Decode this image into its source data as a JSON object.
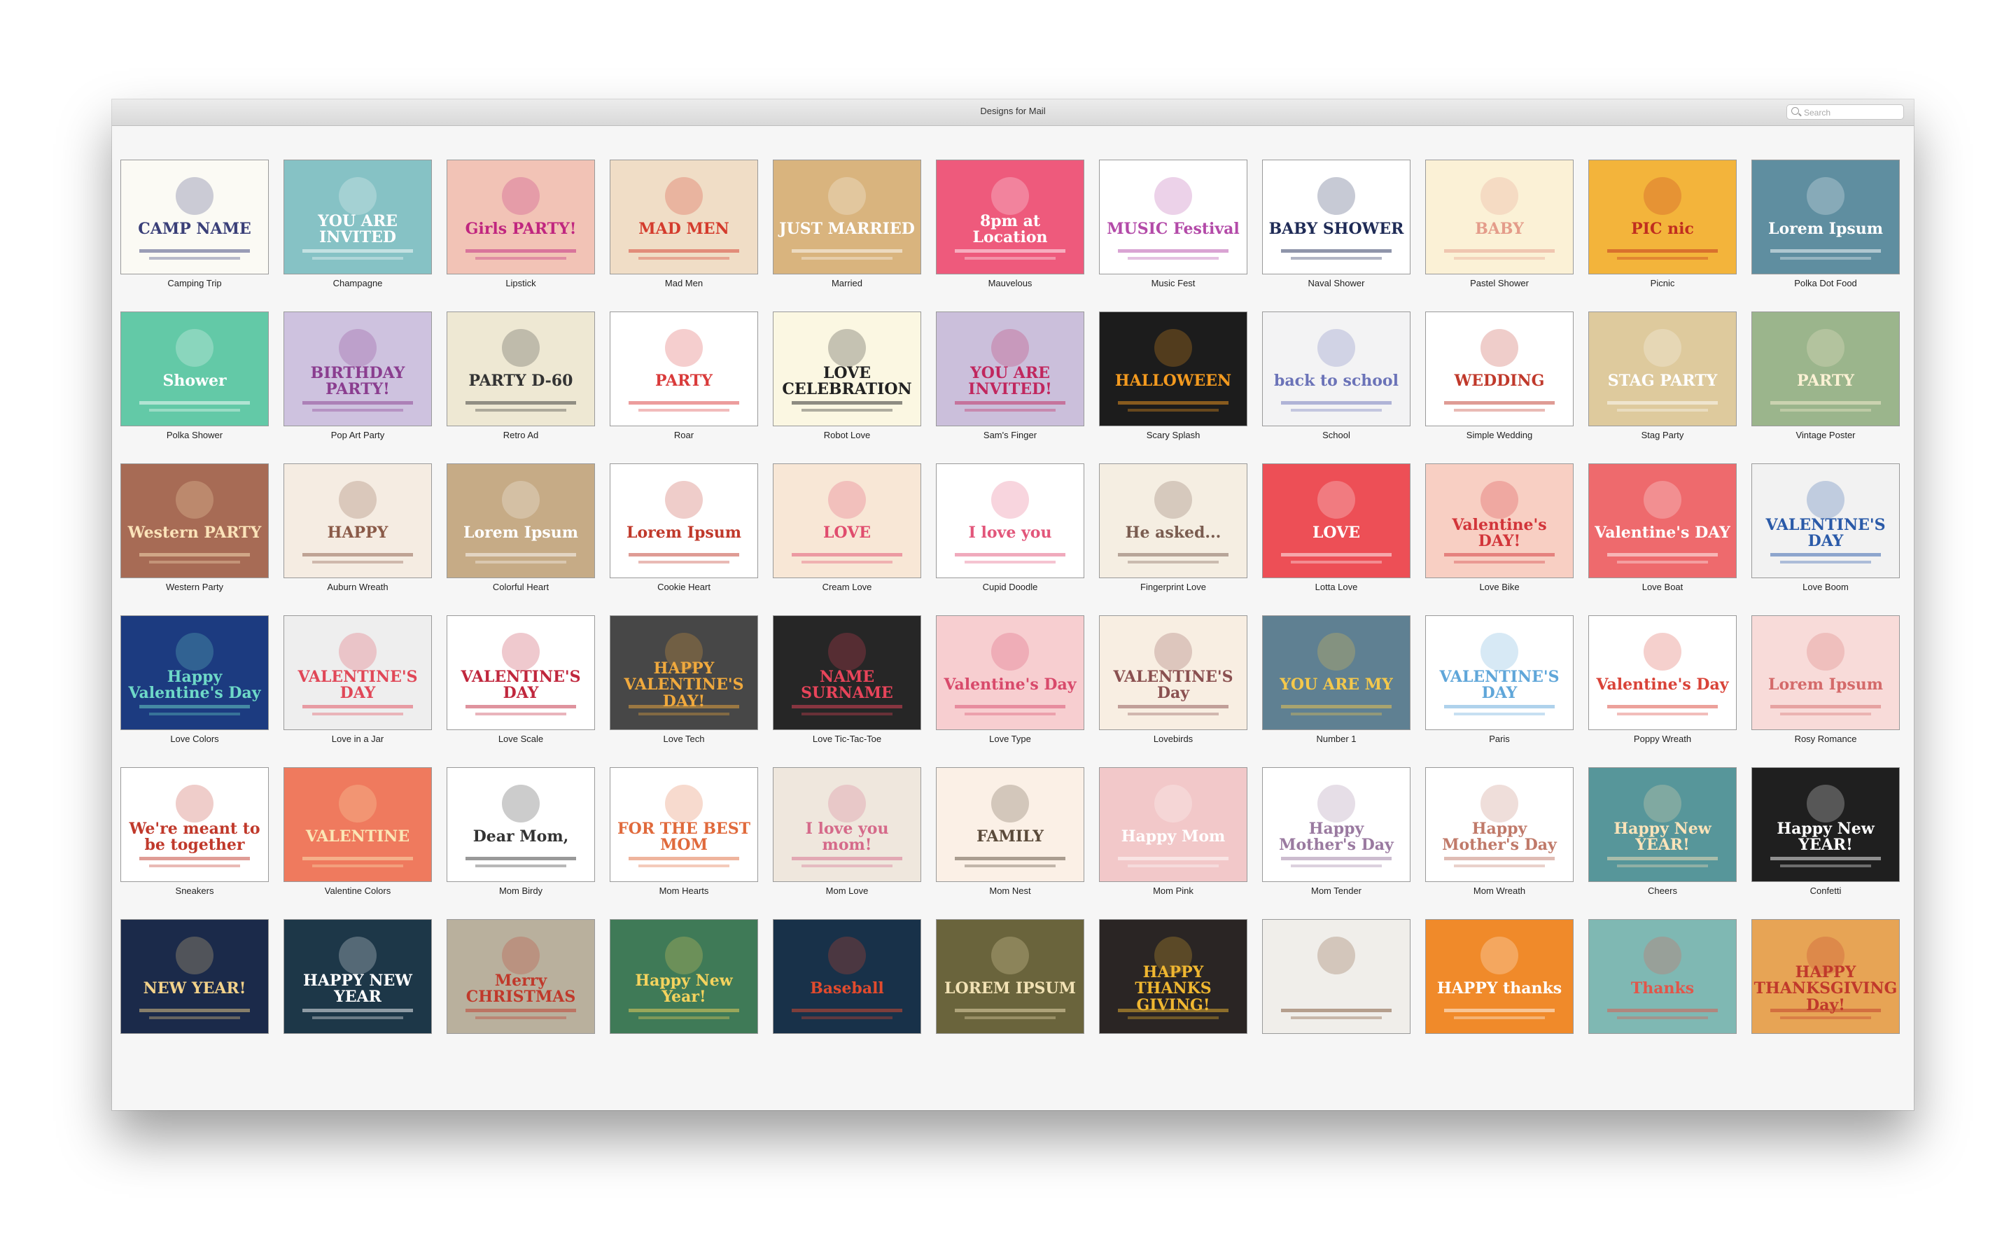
{
  "window": {
    "title": "Designs for Mail",
    "search": {
      "placeholder": "Search",
      "value": ""
    }
  },
  "designs": [
    {
      "name": "Camping Trip",
      "bg": "#fbfaf4",
      "fg": "#3a3f78",
      "hl": "CAMP NAME"
    },
    {
      "name": "Champagne",
      "bg": "#86c2c5",
      "fg": "#ffffff",
      "hl": "YOU ARE INVITED"
    },
    {
      "name": "Lipstick",
      "bg": "#f2c3b6",
      "fg": "#c0267f",
      "hl": "Girls PARTY!"
    },
    {
      "name": "Mad Men",
      "bg": "#f0ddc6",
      "fg": "#d43c2d",
      "hl": "MAD MEN"
    },
    {
      "name": "Married",
      "bg": "#d9b47e",
      "fg": "#ffffff",
      "hl": "JUST MARRIED"
    },
    {
      "name": "Mauvelous",
      "bg": "#ee5a7c",
      "fg": "#ffffff",
      "hl": "8pm at Location"
    },
    {
      "name": "Music Fest",
      "bg": "#ffffff",
      "fg": "#b34aa8",
      "hl": "MUSIC Festival"
    },
    {
      "name": "Naval Shower",
      "bg": "#ffffff",
      "fg": "#1f2b56",
      "hl": "BABY SHOWER"
    },
    {
      "name": "Pastel Shower",
      "bg": "#fbf1d6",
      "fg": "#e49c8a",
      "hl": "BABY"
    },
    {
      "name": "Picnic",
      "bg": "#f3b43b",
      "fg": "#c02e1f",
      "hl": "PIC nic"
    },
    {
      "name": "Polka Dot Food",
      "bg": "#5f8ea0",
      "fg": "#ffffff",
      "hl": "Lorem Ipsum"
    },
    {
      "name": "Polka Shower",
      "bg": "#63c9a7",
      "fg": "#ffffff",
      "hl": "Shower"
    },
    {
      "name": "Pop Art Party",
      "bg": "#cec2df",
      "fg": "#8a3d8f",
      "hl": "BIRTHDAY PARTY!"
    },
    {
      "name": "Retro Ad",
      "bg": "#eee8d3",
      "fg": "#333333",
      "hl": "PARTY D-60"
    },
    {
      "name": "Roar",
      "bg": "#ffffff",
      "fg": "#d93b3b",
      "hl": "PARTY"
    },
    {
      "name": "Robot Love",
      "bg": "#fbf7e2",
      "fg": "#222222",
      "hl": "LOVE CELEBRATION"
    },
    {
      "name": "Sam's Finger",
      "bg": "#cbbfdb",
      "fg": "#c0275e",
      "hl": "YOU ARE INVITED!"
    },
    {
      "name": "Scary Splash",
      "bg": "#1c1c1c",
      "fg": "#f39a1f",
      "hl": "HALLOWEEN"
    },
    {
      "name": "School",
      "bg": "#f3f3f4",
      "fg": "#6b73b8",
      "hl": "back to school"
    },
    {
      "name": "Simple Wedding",
      "bg": "#ffffff",
      "fg": "#c0392b",
      "hl": "WEDDING"
    },
    {
      "name": "Stag Party",
      "bg": "#deca9d",
      "fg": "#ffffff",
      "hl": "STAG PARTY"
    },
    {
      "name": "Vintage Poster",
      "bg": "#9bb58c",
      "fg": "#fbf1d4",
      "hl": "PARTY"
    },
    {
      "name": "Western Party",
      "bg": "#a76b55",
      "fg": "#fbe3b9",
      "hl": "Western PARTY"
    },
    {
      "name": "Auburn Wreath",
      "bg": "#f5ece2",
      "fg": "#8a5a48",
      "hl": "HAPPY"
    },
    {
      "name": "Colorful Heart",
      "bg": "#c6ab86",
      "fg": "#ffffff",
      "hl": "Lorem Ipsum"
    },
    {
      "name": "Cookie Heart",
      "bg": "#ffffff",
      "fg": "#c0392b",
      "hl": "Lorem Ipsum"
    },
    {
      "name": "Cream Love",
      "bg": "#f8e7d6",
      "fg": "#e04d6e",
      "hl": "LOVE"
    },
    {
      "name": "Cupid Doodle",
      "bg": "#ffffff",
      "fg": "#e2567a",
      "hl": "I love you"
    },
    {
      "name": "Fingerprint Love",
      "bg": "#f5eee2",
      "fg": "#7a5c50",
      "hl": "He asked..."
    },
    {
      "name": "Lotta Love",
      "bg": "#ed4f56",
      "fg": "#ffffff",
      "hl": "LOVE"
    },
    {
      "name": "Love Bike",
      "bg": "#f8cfc3",
      "fg": "#d2353a",
      "hl": "Valentine's DAY!"
    },
    {
      "name": "Love Boat",
      "bg": "#ee6a6d",
      "fg": "#ffffff",
      "hl": "Valentine's DAY"
    },
    {
      "name": "Love Boom",
      "bg": "#f2f2f2",
      "fg": "#2a5aa8",
      "hl": "VALENTINE'S DAY"
    },
    {
      "name": "Love Colors",
      "bg": "#1c3b80",
      "fg": "#6ed9c8",
      "hl": "Happy Valentine's Day"
    },
    {
      "name": "Love in a Jar",
      "bg": "#eeeeee",
      "fg": "#e04757",
      "hl": "VALENTINE'S DAY"
    },
    {
      "name": "Love Scale",
      "bg": "#ffffff",
      "fg": "#c0273d",
      "hl": "VALENTINE'S DAY"
    },
    {
      "name": "Love Tech",
      "bg": "#474747",
      "fg": "#f0a93d",
      "hl": "HAPPY VALENTINE'S DAY!"
    },
    {
      "name": "Love Tic-Tac-Toe",
      "bg": "#262626",
      "fg": "#e8445a",
      "hl": "NAME SURNAME"
    },
    {
      "name": "Love Type",
      "bg": "#f7ced0",
      "fg": "#d84a6b",
      "hl": "Valentine's Day"
    },
    {
      "name": "Lovebirds",
      "bg": "#f8eee2",
      "fg": "#8a5050",
      "hl": "VALENTINE'S Day"
    },
    {
      "name": "Number 1",
      "bg": "#5f8092",
      "fg": "#f4c84b",
      "hl": "YOU ARE MY"
    },
    {
      "name": "Paris",
      "bg": "#ffffff",
      "fg": "#5fa6d9",
      "hl": "VALENTINE'S DAY"
    },
    {
      "name": "Poppy Wreath",
      "bg": "#ffffff",
      "fg": "#d94338",
      "hl": "Valentine's Day"
    },
    {
      "name": "Rosy Romance",
      "bg": "#f8dbd9",
      "fg": "#d46a6a",
      "hl": "Lorem Ipsum"
    },
    {
      "name": "Sneakers",
      "bg": "#ffffff",
      "fg": "#c0392b",
      "hl": "We're meant to be together"
    },
    {
      "name": "Valentine Colors",
      "bg": "#ef7a5e",
      "fg": "#fbe6b5",
      "hl": "VALENTINE"
    },
    {
      "name": "Mom Birdy",
      "bg": "#ffffff",
      "fg": "#333333",
      "hl": "Dear Mom,"
    },
    {
      "name": "Mom Hearts",
      "bg": "#ffffff",
      "fg": "#e06a3c",
      "hl": "FOR THE BEST MOM"
    },
    {
      "name": "Mom Love",
      "bg": "#efe7dd",
      "fg": "#d56a8a",
      "hl": "I love you mom!"
    },
    {
      "name": "Mom Nest",
      "bg": "#fbf0e6",
      "fg": "#5a4a3a",
      "hl": "FAMILY"
    },
    {
      "name": "Mom Pink",
      "bg": "#f2c8c9",
      "fg": "#ffffff",
      "hl": "Happy Mom"
    },
    {
      "name": "Mom Tender",
      "bg": "#ffffff",
      "fg": "#9a7aa0",
      "hl": "Happy Mother's Day"
    },
    {
      "name": "Mom Wreath",
      "bg": "#ffffff",
      "fg": "#c07a6a",
      "hl": "Happy Mother's Day"
    },
    {
      "name": "Cheers",
      "bg": "#57969a",
      "fg": "#fbe3b9",
      "hl": "Happy New YEAR!"
    },
    {
      "name": "Confetti",
      "bg": "#1f1f1f",
      "fg": "#ffffff",
      "hl": "Happy New YEAR!"
    },
    {
      "name": "",
      "bg": "#1b2a4a",
      "fg": "#f3d28a",
      "hl": "NEW YEAR!"
    },
    {
      "name": "",
      "bg": "#1d3748",
      "fg": "#ffffff",
      "hl": "HAPPY NEW YEAR"
    },
    {
      "name": "",
      "bg": "#b9b09d",
      "fg": "#c0392b",
      "hl": "Merry CHRISTMAS"
    },
    {
      "name": "",
      "bg": "#3f7a57",
      "fg": "#f4d35e",
      "hl": "Happy New Year!"
    },
    {
      "name": "",
      "bg": "#183149",
      "fg": "#e24b2d",
      "hl": "Baseball"
    },
    {
      "name": "",
      "bg": "#6a643c",
      "fg": "#f2e2b5",
      "hl": "LOREM IPSUM"
    },
    {
      "name": "",
      "bg": "#2a2524",
      "fg": "#f0b731",
      "hl": "HAPPY THANKS GIVING!"
    },
    {
      "name": "",
      "bg": "#f0eeea",
      "fg": "#7a5030",
      "hl": ""
    },
    {
      "name": "",
      "bg": "#f08a2a",
      "fg": "#ffffff",
      "hl": "HAPPY thanks"
    },
    {
      "name": "",
      "bg": "#7fb8b3",
      "fg": "#e2564a",
      "hl": "Thanks"
    },
    {
      "name": "",
      "bg": "#e7a455",
      "fg": "#c0392b",
      "hl": "HAPPY THANKSGIVING Day!"
    }
  ]
}
